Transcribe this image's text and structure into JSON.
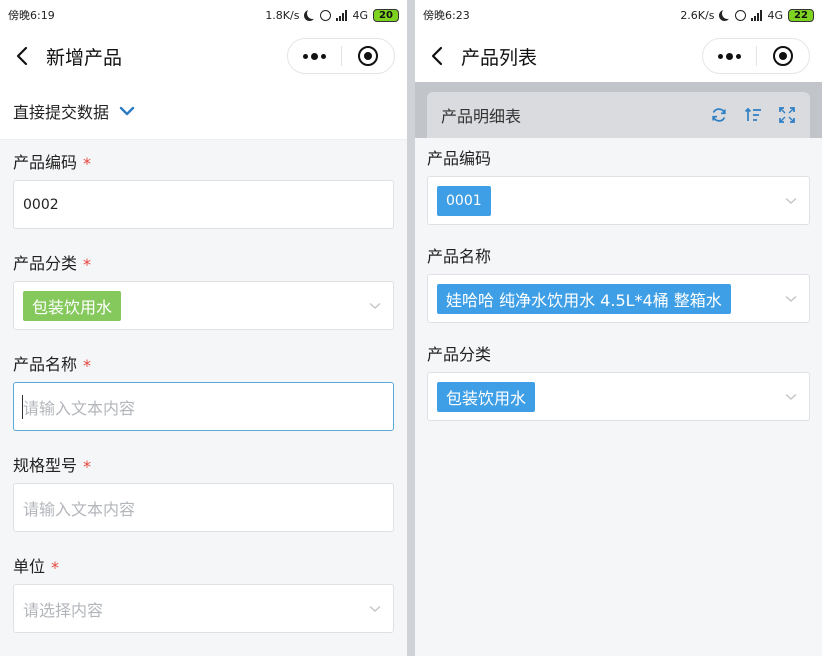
{
  "left": {
    "status": {
      "time": "傍晚6:19",
      "speed": "1.8K/s",
      "network": "4G",
      "battery": "20"
    },
    "nav": {
      "title": "新增产品"
    },
    "submit_toggle": "直接提交数据",
    "fields": {
      "code": {
        "label": "产品编码",
        "required": "*",
        "value": "0002"
      },
      "category": {
        "label": "产品分类",
        "required": "*",
        "value": "包装饮用水"
      },
      "name": {
        "label": "产品名称",
        "required": "*",
        "placeholder": "请输入文本内容"
      },
      "spec": {
        "label": "规格型号",
        "required": "*",
        "placeholder": "请输入文本内容"
      },
      "unit": {
        "label": "单位",
        "required": "*",
        "placeholder": "请选择内容"
      }
    }
  },
  "right": {
    "status": {
      "time": "傍晚6:23",
      "speed": "2.6K/s",
      "network": "4G",
      "battery": "22"
    },
    "nav": {
      "title": "产品列表"
    },
    "table": {
      "title": "产品明细表"
    },
    "fields": {
      "code": {
        "label": "产品编码",
        "value": "0001"
      },
      "name": {
        "label": "产品名称",
        "value": "娃哈哈 纯净水饮用水 4.5L*4桶 整箱水"
      },
      "category": {
        "label": "产品分类",
        "value": "包装饮用水"
      }
    }
  },
  "colors": {
    "tag_green": "#85c95c",
    "tag_blue": "#3f9fe6",
    "required": "#e6453a",
    "focus_border": "#5aa9d6"
  },
  "icons": [
    "back-arrow-icon",
    "more-dots-icon",
    "target-icon",
    "chevron-down-icon",
    "refresh-icon",
    "sort-icon",
    "expand-icon",
    "moon-icon",
    "alarm-icon",
    "signal-icon"
  ]
}
